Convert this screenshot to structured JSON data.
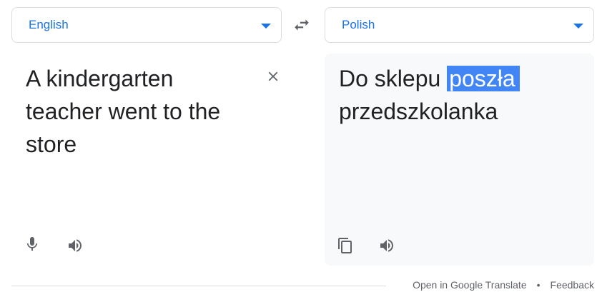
{
  "source_language": {
    "label": "English"
  },
  "target_language": {
    "label": "Polish"
  },
  "source": {
    "text": "A kindergarten teacher went to the store"
  },
  "target": {
    "text_before": "Do sklepu ",
    "text_highlighted": "poszła",
    "text_after": " przedszkolanka"
  },
  "footer": {
    "open_link": "Open in Google Translate",
    "separator": "•",
    "feedback_link": "Feedback"
  },
  "colors": {
    "accent": "#1a73e8",
    "highlight": "#4285f4",
    "icon": "#5f6368",
    "target_bg": "#f8f9fa"
  },
  "icons": {
    "swap": "swap-horiz-icon",
    "clear": "close-icon",
    "mic": "mic-icon",
    "speaker": "volume-up-icon",
    "copy": "content-copy-icon",
    "dropdown": "arrow-drop-down-icon"
  }
}
